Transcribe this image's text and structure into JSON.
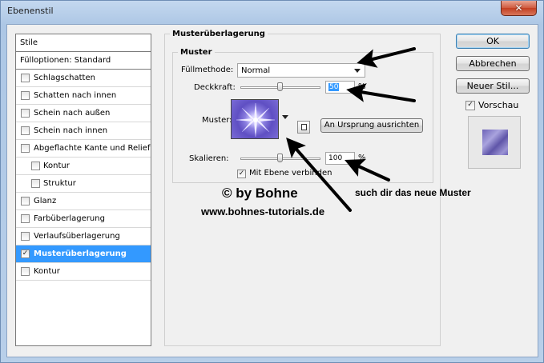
{
  "window": {
    "title": "Ebenenstil",
    "close_glyph": "✕"
  },
  "style_list": {
    "header": "Stile",
    "blend_options": "Fülloptionen: Standard",
    "items": [
      {
        "label": "Schlagschatten",
        "checked": false,
        "indent": false,
        "selected": false
      },
      {
        "label": "Schatten nach innen",
        "checked": false,
        "indent": false,
        "selected": false
      },
      {
        "label": "Schein nach außen",
        "checked": false,
        "indent": false,
        "selected": false
      },
      {
        "label": "Schein nach innen",
        "checked": false,
        "indent": false,
        "selected": false
      },
      {
        "label": "Abgeflachte Kante und Relief",
        "checked": false,
        "indent": false,
        "selected": false
      },
      {
        "label": "Kontur",
        "checked": false,
        "indent": true,
        "selected": false
      },
      {
        "label": "Struktur",
        "checked": false,
        "indent": true,
        "selected": false
      },
      {
        "label": "Glanz",
        "checked": false,
        "indent": false,
        "selected": false
      },
      {
        "label": "Farbüberlagerung",
        "checked": false,
        "indent": false,
        "selected": false
      },
      {
        "label": "Verlaufsüberlagerung",
        "checked": false,
        "indent": false,
        "selected": false
      },
      {
        "label": "Musterüberlagerung",
        "checked": true,
        "indent": false,
        "selected": true
      },
      {
        "label": "Kontur",
        "checked": false,
        "indent": false,
        "selected": false
      }
    ],
    "check_glyph": "✓"
  },
  "panel": {
    "outer_title": "Musterüberlagerung",
    "inner_title": "Muster",
    "blend_mode_label": "Füllmethode:",
    "blend_mode_value": "Normal",
    "opacity_label": "Deckkraft:",
    "opacity_value": "50",
    "opacity_fraction": 0.5,
    "opacity_unit": "%",
    "pattern_label": "Muster:",
    "snap_button": "An Ursprung ausrichten",
    "scale_label": "Skalieren:",
    "scale_value": "100",
    "scale_fraction": 0.5,
    "scale_unit": "%",
    "link_label": "Mit Ebene verbinden",
    "link_checked": true
  },
  "buttons": {
    "ok": "OK",
    "cancel": "Abbrechen",
    "new_style": "Neuer Stil...",
    "preview_label": "Vorschau",
    "preview_checked": true
  },
  "annotations": {
    "copyright": "© by Bohne",
    "url": "www.bohnes-tutorials.de",
    "hint": "such dir das neue Muster"
  }
}
